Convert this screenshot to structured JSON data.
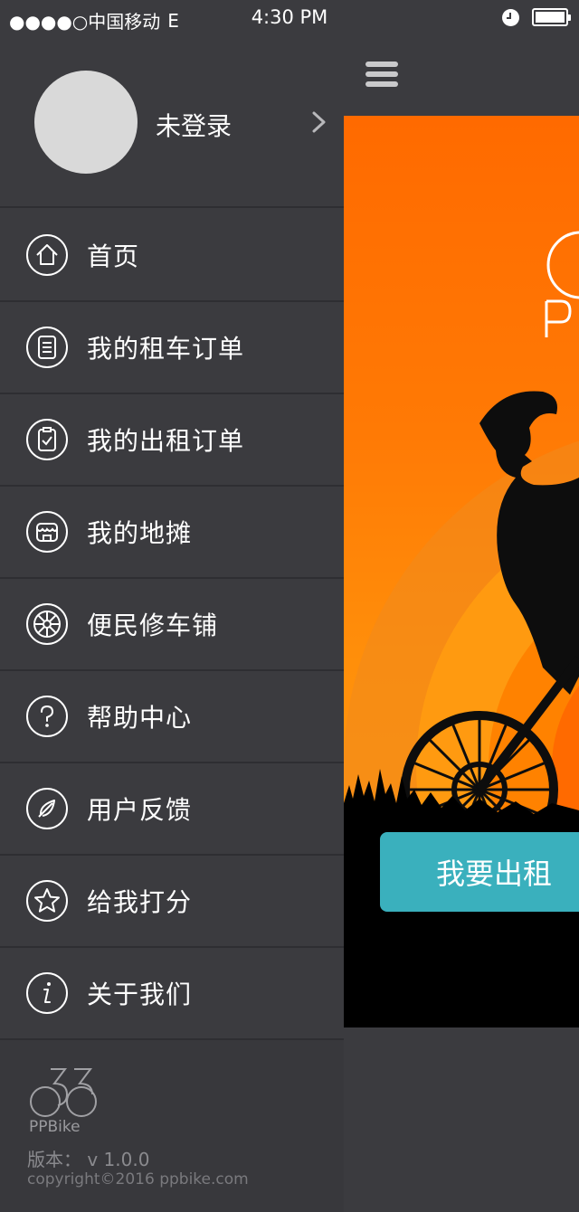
{
  "status_bar": {
    "carrier": "●●●●○中国移动",
    "network": "E",
    "time": "4:30 PM"
  },
  "sidebar": {
    "profile": {
      "login_label": "未登录"
    },
    "items": [
      {
        "label": "首页",
        "icon": "home-icon"
      },
      {
        "label": "我的租车订单",
        "icon": "order-list-icon"
      },
      {
        "label": "我的出租订单",
        "icon": "clipboard-check-icon"
      },
      {
        "label": "我的地摊",
        "icon": "shop-icon"
      },
      {
        "label": "便民修车铺",
        "icon": "wheel-icon"
      },
      {
        "label": "帮助中心",
        "icon": "help-icon"
      },
      {
        "label": "用户反馈",
        "icon": "feather-icon"
      },
      {
        "label": "给我打分",
        "icon": "star-icon"
      },
      {
        "label": "关于我们",
        "icon": "info-icon"
      }
    ],
    "footer": {
      "logo_text": "PPBike",
      "version": "版本： v 1.0.0",
      "copyright": "copyright©2016 ppbike.com"
    }
  },
  "main": {
    "rent_button": "我要出租"
  },
  "colors": {
    "sidebar_bg": "#3b3b3f",
    "divider": "#2e2e32",
    "hero_orange": "#ff7a05",
    "accent_teal": "#3ab0bd"
  }
}
